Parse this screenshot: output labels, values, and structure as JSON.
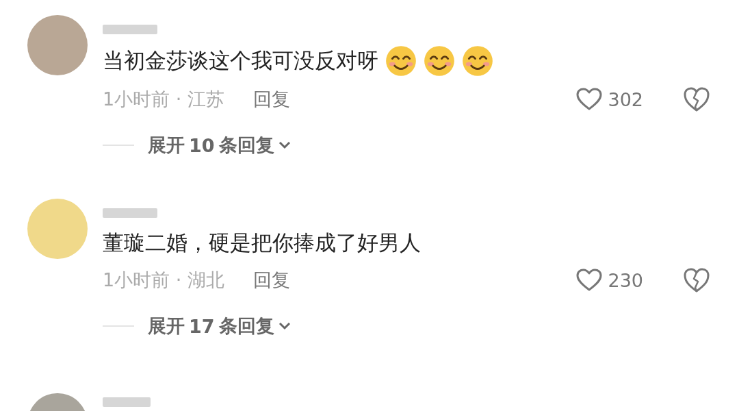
{
  "comments": [
    {
      "text": "当初金莎谈这个我可没反对呀",
      "reactions": [
        {
          "kind": "smile"
        },
        {
          "kind": "smile"
        },
        {
          "kind": "smile"
        }
      ],
      "time_location": "1小时前 · 江苏",
      "reply": "回复",
      "likes": "302",
      "expand": {
        "prefix": "展开",
        "count": "10",
        "suffix": "条回复"
      }
    },
    {
      "text": "董璇二婚，硬是把你捧成了好男人",
      "time_location": "1小时前 · 湖北",
      "reply": "回复",
      "likes": "230",
      "expand": {
        "prefix": "展开",
        "count": "17",
        "suffix": "条回复"
      }
    }
  ]
}
